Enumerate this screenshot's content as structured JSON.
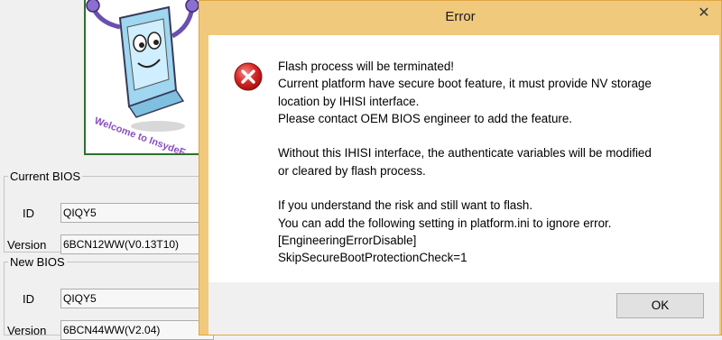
{
  "background_app": {
    "logo": {
      "icon": "insyde-mascot-icon",
      "welcome_text": "Welcome to InsydeF"
    },
    "current_bios": {
      "legend": "Current BIOS",
      "id_label": "ID",
      "id_value": "QIQY5",
      "version_label": "Version",
      "version_value": "6BCN12WW(V0.13T10)"
    },
    "new_bios": {
      "legend": "New BIOS",
      "id_label": "ID",
      "id_value": "QIQY5",
      "version_label": "Version",
      "version_value": "6BCN44WW(V2.04)"
    }
  },
  "dialog": {
    "title": "Error",
    "close_glyph": "✕",
    "icon": "error-icon",
    "accent_color": "#f1c97c",
    "message_lines": [
      "Flash process will be terminated!",
      "Current platform have secure boot feature, it must provide NV storage",
      "location by IHISI interface.",
      "Please contact OEM BIOS engineer to add the feature.",
      "",
      "Without this IHISI interface, the authenticate variables will be modified",
      "or cleared by flash process.",
      "",
      "If you understand the risk and still want to flash.",
      "You can add the following setting in platform.ini to ignore error.",
      "[EngineeringErrorDisable]",
      "SkipSecureBootProtectionCheck=1"
    ],
    "ok_label": "OK"
  }
}
